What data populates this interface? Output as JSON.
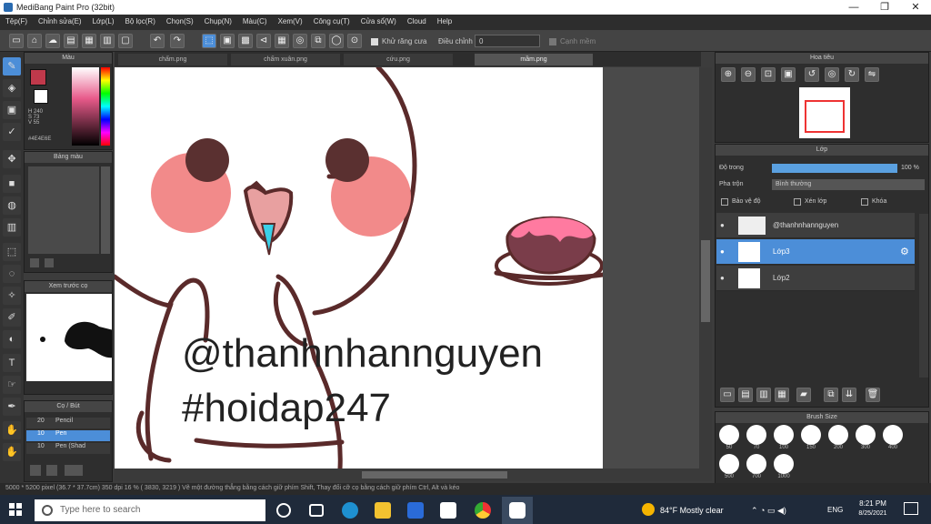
{
  "window": {
    "title": "MediBang Paint Pro (32bit)",
    "min": "—",
    "max": "❐",
    "close": "✕"
  },
  "menu": [
    "Tệp(F)",
    "Chỉnh sửa(E)",
    "Lớp(L)",
    "Bộ lọc(R)",
    "Chọn(S)",
    "Chụp(N)",
    "Màu(C)",
    "Xem(V)",
    "Công cụ(T)",
    "Cửa sổ(W)",
    "Cloud",
    "Help"
  ],
  "toolbar": {
    "correction_label": "Khử răng cưa",
    "adjust_label": "Điều chỉnh",
    "adjust_value": "0",
    "edge_label": "Cạnh mềm"
  },
  "tabs": [
    "chấm.png",
    "chấm xuân.png",
    "cứu.png",
    "mầm.png"
  ],
  "color_panel": {
    "title": "Màu",
    "hsv": "H 240\nS 73\nV 55",
    "hex": "#4E4E6E"
  },
  "palette_panel": {
    "title": "Bảng màu"
  },
  "preview_panel": {
    "title": "Xem trước cọ"
  },
  "brush_panel": {
    "title": "Cọ / Bút",
    "items": [
      {
        "size": "20",
        "name": "Pencil"
      },
      {
        "size": "10",
        "name": "Pen"
      },
      {
        "size": "10",
        "name": "Pen (Shad"
      }
    ]
  },
  "navigator": {
    "title": "Hoa tiêu"
  },
  "layers": {
    "title": "Lớp",
    "opacity_label": "Độ trong",
    "opacity_value": "100 %",
    "blend_label": "Pha trộn",
    "blend_value": "Bình thường",
    "protect_label": "Bảo vệ độ",
    "clip_label": "Xén lớp",
    "lock_label": "Khóa",
    "items": [
      {
        "name": "@thanhnhannguyen"
      },
      {
        "name": "Lớp3"
      },
      {
        "name": "Lớp2"
      }
    ]
  },
  "brush_size": {
    "title": "Brush Size",
    "sizes": [
      "50",
      "70",
      "100",
      "150",
      "200",
      "300",
      "400",
      "500",
      "700",
      "1000"
    ]
  },
  "canvas_text": {
    "line1": "@thanhnhannguyen",
    "line2": "#hoidap247"
  },
  "status": "5000 * 5200 pixel   (36.7 * 37.7cm)   350 dpi   16 %   ( 3830, 3219 )   Vẽ một đường thẳng bằng cách giữ phím Shift, Thay đổi cỡ cọ bằng cách giữ phím Ctrl, Alt và kéo",
  "taskbar": {
    "search_placeholder": "Type here to search",
    "weather": "84°F  Mostly clear",
    "time": "8:21 PM",
    "date": "8/25/2021",
    "lang": "ENG"
  }
}
